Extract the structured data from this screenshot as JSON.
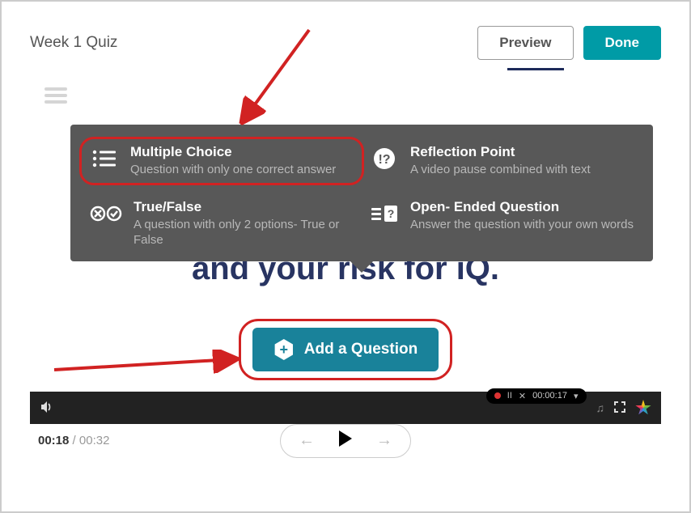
{
  "header": {
    "title": "Week 1 Quiz",
    "preview_label": "Preview",
    "done_label": "Done"
  },
  "slide_text": "Tell us a little bit about yourself and your risk for iQ.",
  "options": {
    "mc": {
      "title": "Multiple Choice",
      "desc": "Question with only one correct answer"
    },
    "rp": {
      "title": "Reflection Point",
      "desc": "A video pause combined with text"
    },
    "tf": {
      "title": "True/False",
      "desc": "A question with only 2 options- True or False"
    },
    "oe": {
      "title": "Open- Ended Question",
      "desc": "Answer the question with your own words"
    }
  },
  "add_label": "Add a Question",
  "time": {
    "current": "00:18",
    "total": "00:32"
  },
  "rec": {
    "time": "00:00:17"
  }
}
